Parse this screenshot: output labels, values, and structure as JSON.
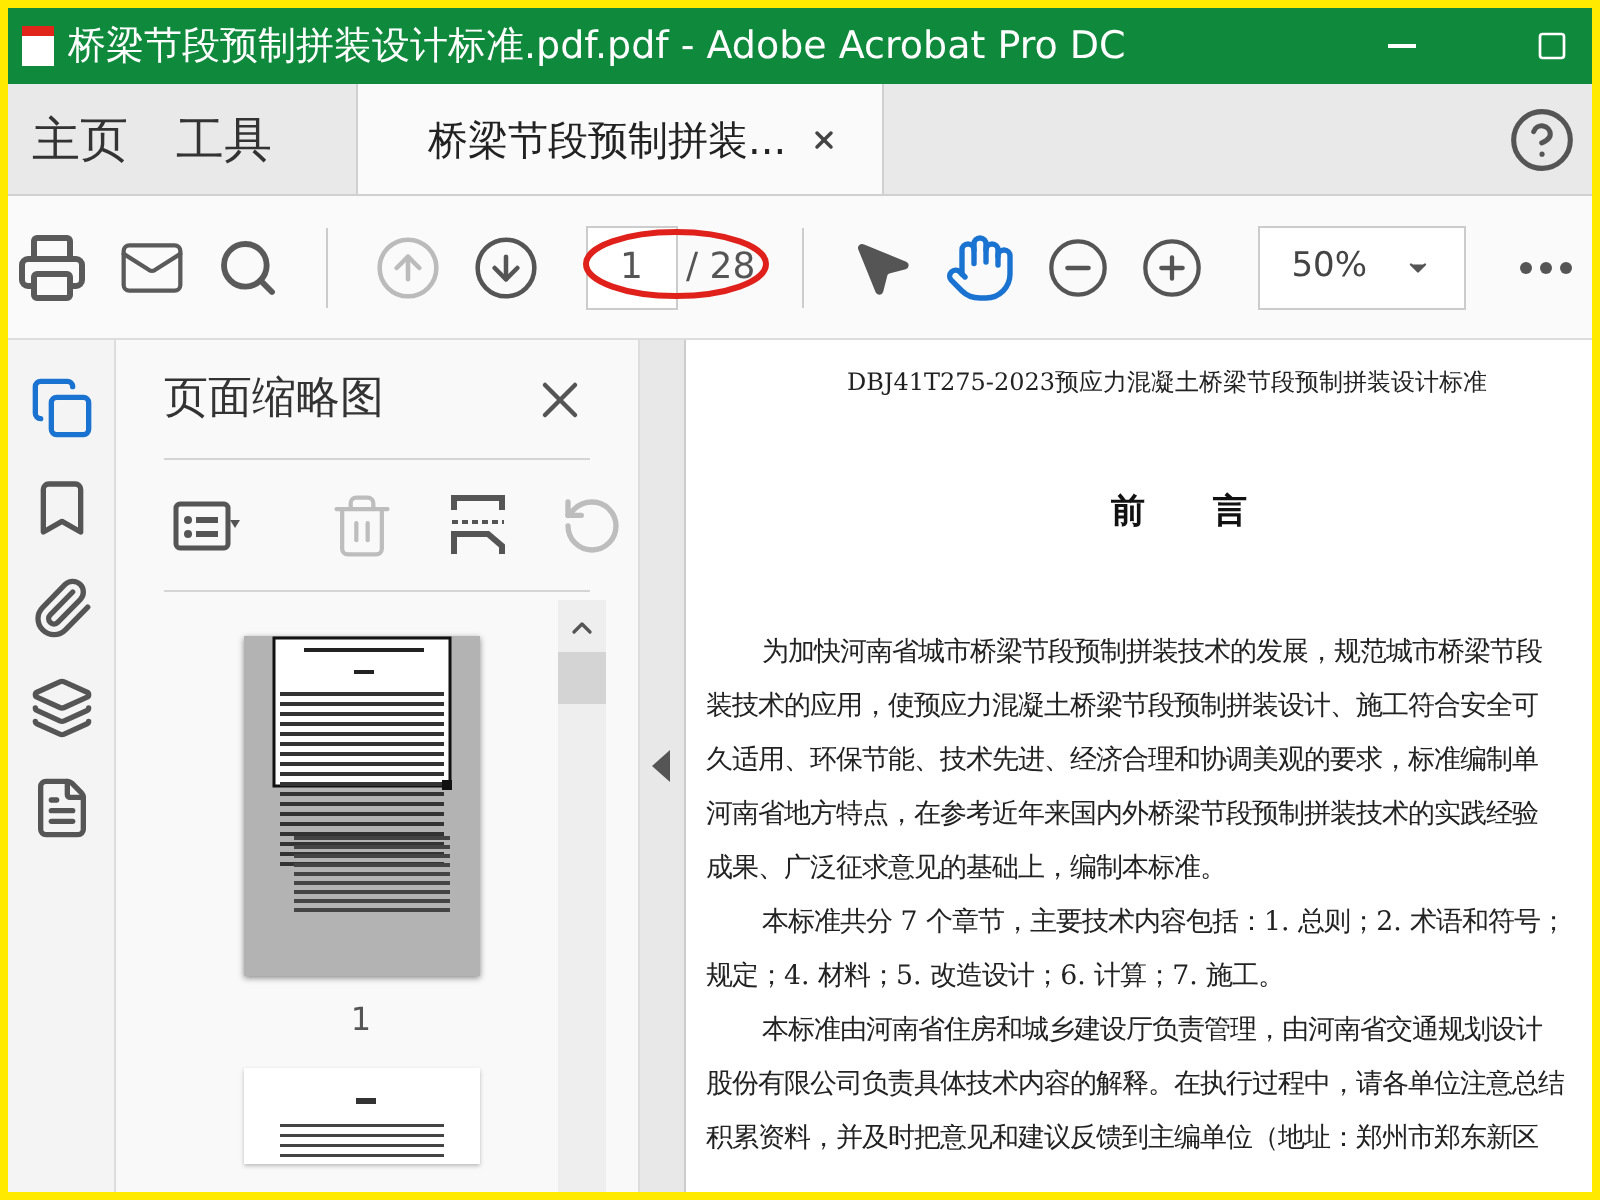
{
  "window": {
    "title": "桥梁节段预制拼装设计标准.pdf.pdf - Adobe Acrobat Pro DC"
  },
  "nav_tabs": [
    {
      "label": "主页",
      "selected": false
    },
    {
      "label": "工具",
      "selected": false
    }
  ],
  "document_tab": {
    "label": "桥梁节段预制拼装...",
    "selected": true
  },
  "toolbar": {
    "page_nav": [
      {
        "kind": "up",
        "disabled": true
      },
      {
        "kind": "down",
        "disabled": false
      }
    ],
    "page_number": "1",
    "page_total": "/ 28",
    "tools": [
      {
        "kind": "select",
        "selected": false
      },
      {
        "kind": "hand",
        "selected": true
      }
    ],
    "zoom": "50%"
  },
  "rail_items": [
    {
      "kind": "pages",
      "selected": true
    },
    {
      "kind": "bookmarks",
      "selected": false
    },
    {
      "kind": "attachments",
      "selected": false
    },
    {
      "kind": "layers",
      "selected": false
    },
    {
      "kind": "document",
      "selected": false
    }
  ],
  "panel": {
    "title": "页面缩略图",
    "tools": [
      {
        "kind": "options",
        "disabled": false
      },
      {
        "kind": "delete",
        "disabled": true
      },
      {
        "kind": "extract",
        "disabled": false
      },
      {
        "kind": "rotate",
        "disabled": true
      }
    ],
    "thumbnails": [
      {
        "label": "1",
        "selected": true
      },
      {
        "selected": false
      }
    ]
  },
  "document": {
    "header": "DBJ41T275-2023预应力混凝土桥梁节段预制拼装设计标准",
    "heading": "前　　言",
    "lines": [
      {
        "text": "为加快河南省城市桥梁节段预制拼装技术的发展，规范城市桥梁节段",
        "indent": true
      },
      {
        "text": "装技术的应用，使预应力混凝土桥梁节段预制拼装设计、施工符合安全可",
        "indent": false
      },
      {
        "text": "久适用、环保节能、技术先进、经济合理和协调美观的要求，标准编制单",
        "indent": false
      },
      {
        "text": "河南省地方特点，在参考近年来国内外桥梁节段预制拼装技术的实践经验",
        "indent": false
      },
      {
        "text": "成果、广泛征求意见的基础上，编制本标准。",
        "indent": false
      },
      {
        "text": "本标准共分 7 个章节，主要技术内容包括：1. 总则；2. 术语和符号；",
        "indent": true
      },
      {
        "text": "规定；4. 材料；5. 改造设计；6. 计算；7. 施工。",
        "indent": false
      },
      {
        "text": "本标准由河南省住房和城乡建设厅负责管理，由河南省交通规划设计",
        "indent": true
      },
      {
        "text": "股份有限公司负责具体技术内容的解释。在执行过程中，请各单位注意总结",
        "indent": false
      },
      {
        "text": "积累资料，并及时把意见和建议反馈到主编单位（地址：郑州市郑东新区",
        "indent": false
      }
    ]
  }
}
